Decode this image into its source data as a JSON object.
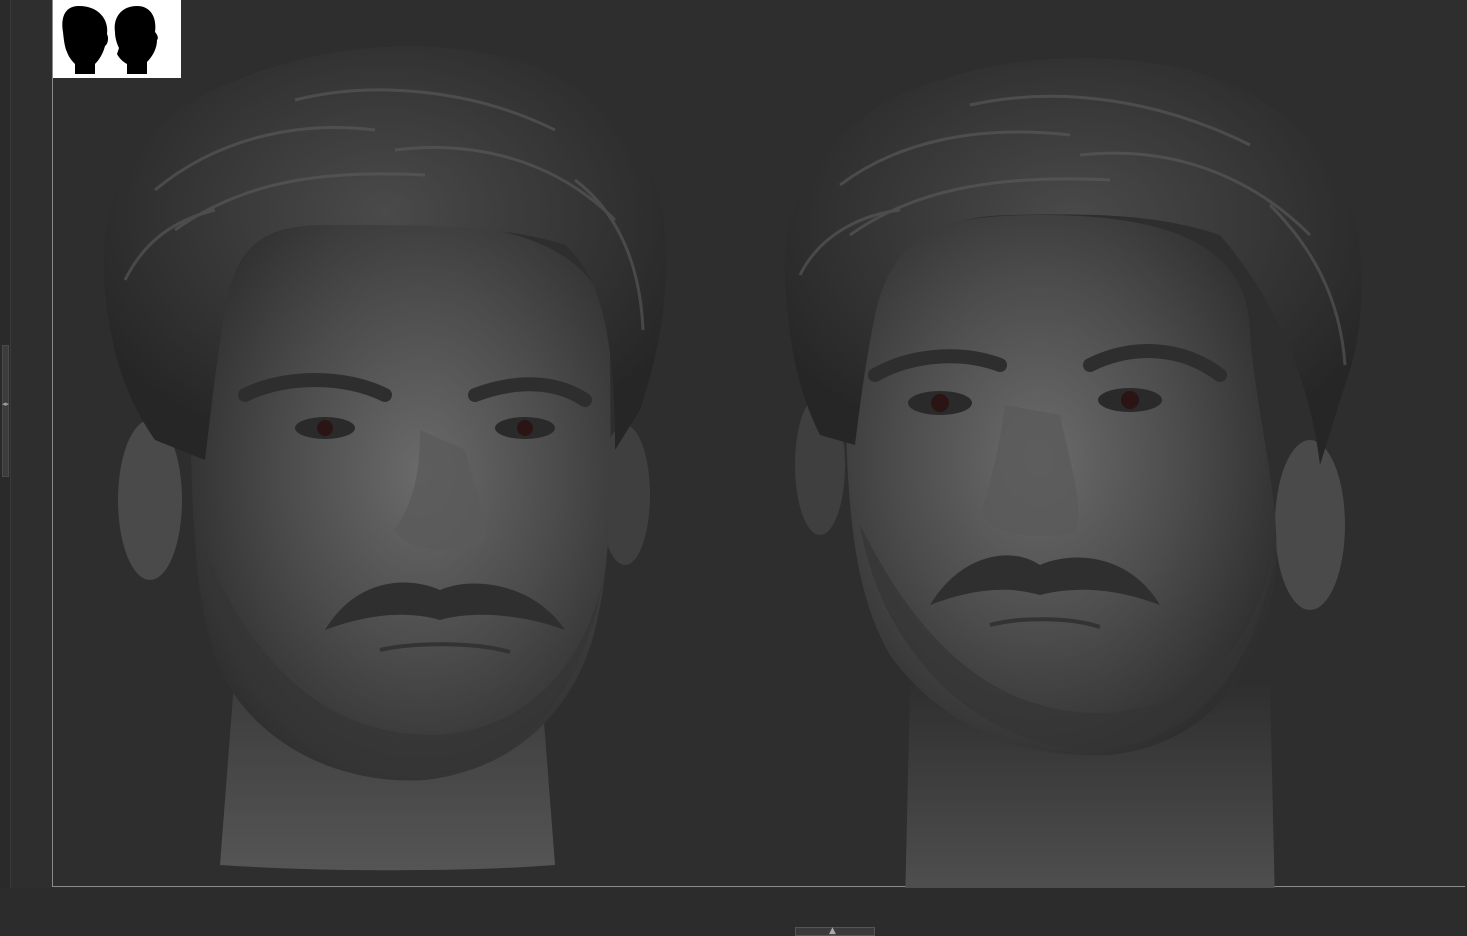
{
  "viewport": {
    "background": "#2e2e2e",
    "frame_color": "#8a8a8a"
  },
  "navigator": {
    "background": "#ffffff",
    "silhouette_color": "#000000",
    "icons": [
      "head-front-silhouette-icon",
      "head-side-silhouette-icon"
    ]
  },
  "models": [
    {
      "name": "head-sculpt-left",
      "view": "front-left",
      "material_color": "#4a4a4a"
    },
    {
      "name": "head-sculpt-right",
      "view": "front-right",
      "material_color": "#4a4a4a"
    }
  ],
  "controls": {
    "left_edge_arrow": "◂▸",
    "bottom_arrow": "▲"
  }
}
